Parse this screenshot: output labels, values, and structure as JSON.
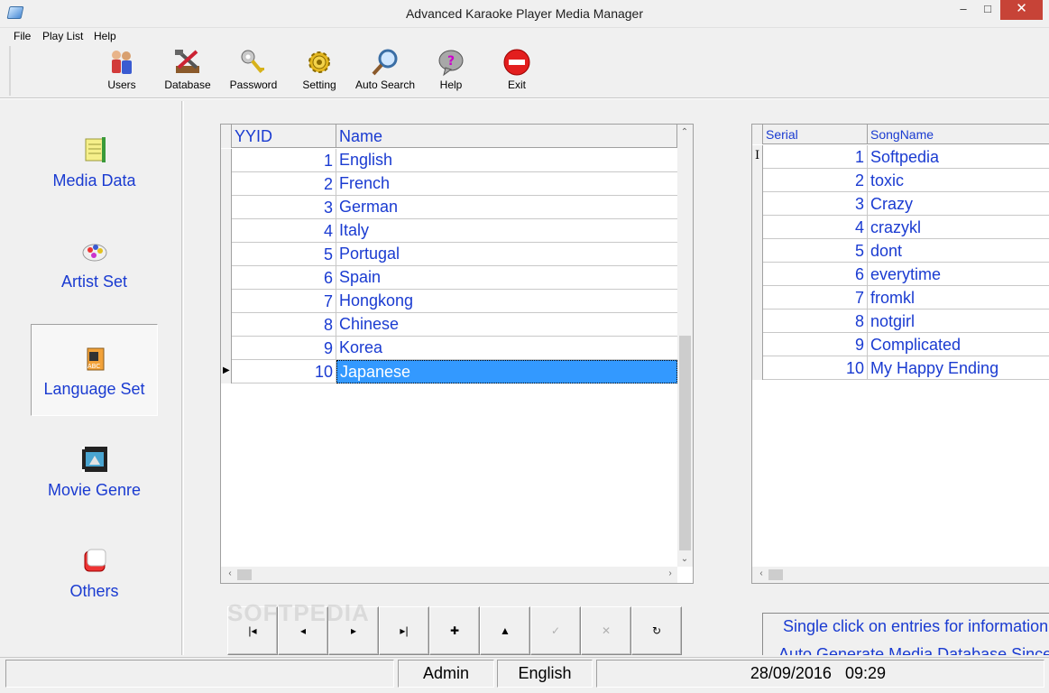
{
  "window": {
    "title": "Advanced Karaoke Player Media Manager",
    "minimize_glyph": "–",
    "maximize_glyph": "□",
    "close_glyph": "✕"
  },
  "menu": [
    "File",
    "Play List",
    "Help"
  ],
  "toolbar": [
    {
      "label": "Users",
      "icon": "users-icon"
    },
    {
      "label": "Database",
      "icon": "database-tools-icon"
    },
    {
      "label": "Password",
      "icon": "key-icon"
    },
    {
      "label": "Setting",
      "icon": "gear-icon"
    },
    {
      "label": "Auto Search",
      "icon": "magnifier-icon"
    },
    {
      "label": "Help",
      "icon": "help-bubble-icon"
    },
    {
      "label": "Exit",
      "icon": "exit-icon"
    }
  ],
  "nav": [
    {
      "label": "Media Data",
      "icon": "media-data-icon"
    },
    {
      "label": "Artist Set",
      "icon": "artist-set-icon"
    },
    {
      "label": "Language Set",
      "icon": "language-set-icon"
    },
    {
      "label": "Movie Genre",
      "icon": "movie-genre-icon"
    },
    {
      "label": "Others",
      "icon": "others-icon"
    }
  ],
  "language_grid": {
    "columns": [
      "YYID",
      "Name"
    ],
    "rows": [
      {
        "id": "1",
        "name": "English"
      },
      {
        "id": "2",
        "name": "French"
      },
      {
        "id": "3",
        "name": "German"
      },
      {
        "id": "4",
        "name": "Italy"
      },
      {
        "id": "5",
        "name": "Portugal"
      },
      {
        "id": "6",
        "name": "Spain"
      },
      {
        "id": "7",
        "name": "Hongkong"
      },
      {
        "id": "8",
        "name": "Chinese"
      },
      {
        "id": "9",
        "name": "Korea"
      },
      {
        "id": "10",
        "name": "Japanese"
      }
    ],
    "selected_row": 10
  },
  "song_grid": {
    "columns": [
      "Serial",
      "SongName"
    ],
    "rows": [
      {
        "serial": "1",
        "name": "Softpedia"
      },
      {
        "serial": "2",
        "name": "toxic"
      },
      {
        "serial": "3",
        "name": "Crazy"
      },
      {
        "serial": "4",
        "name": "crazykl"
      },
      {
        "serial": "5",
        "name": "dont"
      },
      {
        "serial": "6",
        "name": "everytime"
      },
      {
        "serial": "7",
        "name": "fromkl"
      },
      {
        "serial": "8",
        "name": "notgirl"
      },
      {
        "serial": "9",
        "name": "Complicated"
      },
      {
        "serial": "10",
        "name": "My Happy Ending"
      }
    ]
  },
  "nav_buttons": [
    {
      "name": "first-record-button",
      "glyph": "|◂",
      "enabled": true
    },
    {
      "name": "prior-record-button",
      "glyph": "◂",
      "enabled": true
    },
    {
      "name": "next-record-button",
      "glyph": "▸",
      "enabled": true
    },
    {
      "name": "last-record-button",
      "glyph": "▸|",
      "enabled": true
    },
    {
      "name": "insert-record-button",
      "glyph": "✚",
      "enabled": true
    },
    {
      "name": "edit-record-button",
      "glyph": "▲",
      "enabled": true
    },
    {
      "name": "post-record-button",
      "glyph": "✓",
      "enabled": false
    },
    {
      "name": "cancel-record-button",
      "glyph": "✕",
      "enabled": false
    },
    {
      "name": "refresh-record-button",
      "glyph": "↻",
      "enabled": true
    }
  ],
  "info": {
    "line1": "Single click on entries for information",
    "line2": "Auto Generate Media Database Since"
  },
  "status": {
    "user": "Admin",
    "language": "English",
    "date": "28/09/2016",
    "time": "09:29"
  },
  "watermark": "SOFTPEDIA"
}
